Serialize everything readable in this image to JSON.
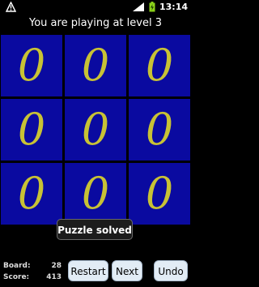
{
  "status_bar": {
    "time": "13:14",
    "left_icon": "warning-triangle-icon",
    "signal_icon": "signal-icon",
    "battery_icon": "battery-icon"
  },
  "header": {
    "title": "You are playing at level 3"
  },
  "board": {
    "tiles": [
      "0",
      "0",
      "0",
      "0",
      "0",
      "0",
      "0",
      "0",
      "0"
    ],
    "tile_color": "#0a0aa0",
    "digit_color": "#c8c235"
  },
  "toast": {
    "message": "Puzzle solved"
  },
  "stats": {
    "board_label": "Board:",
    "board_value": "28",
    "score_label": "Score:",
    "score_value": "413"
  },
  "buttons": {
    "restart": "Restart",
    "next": "Next",
    "undo": "Undo"
  }
}
